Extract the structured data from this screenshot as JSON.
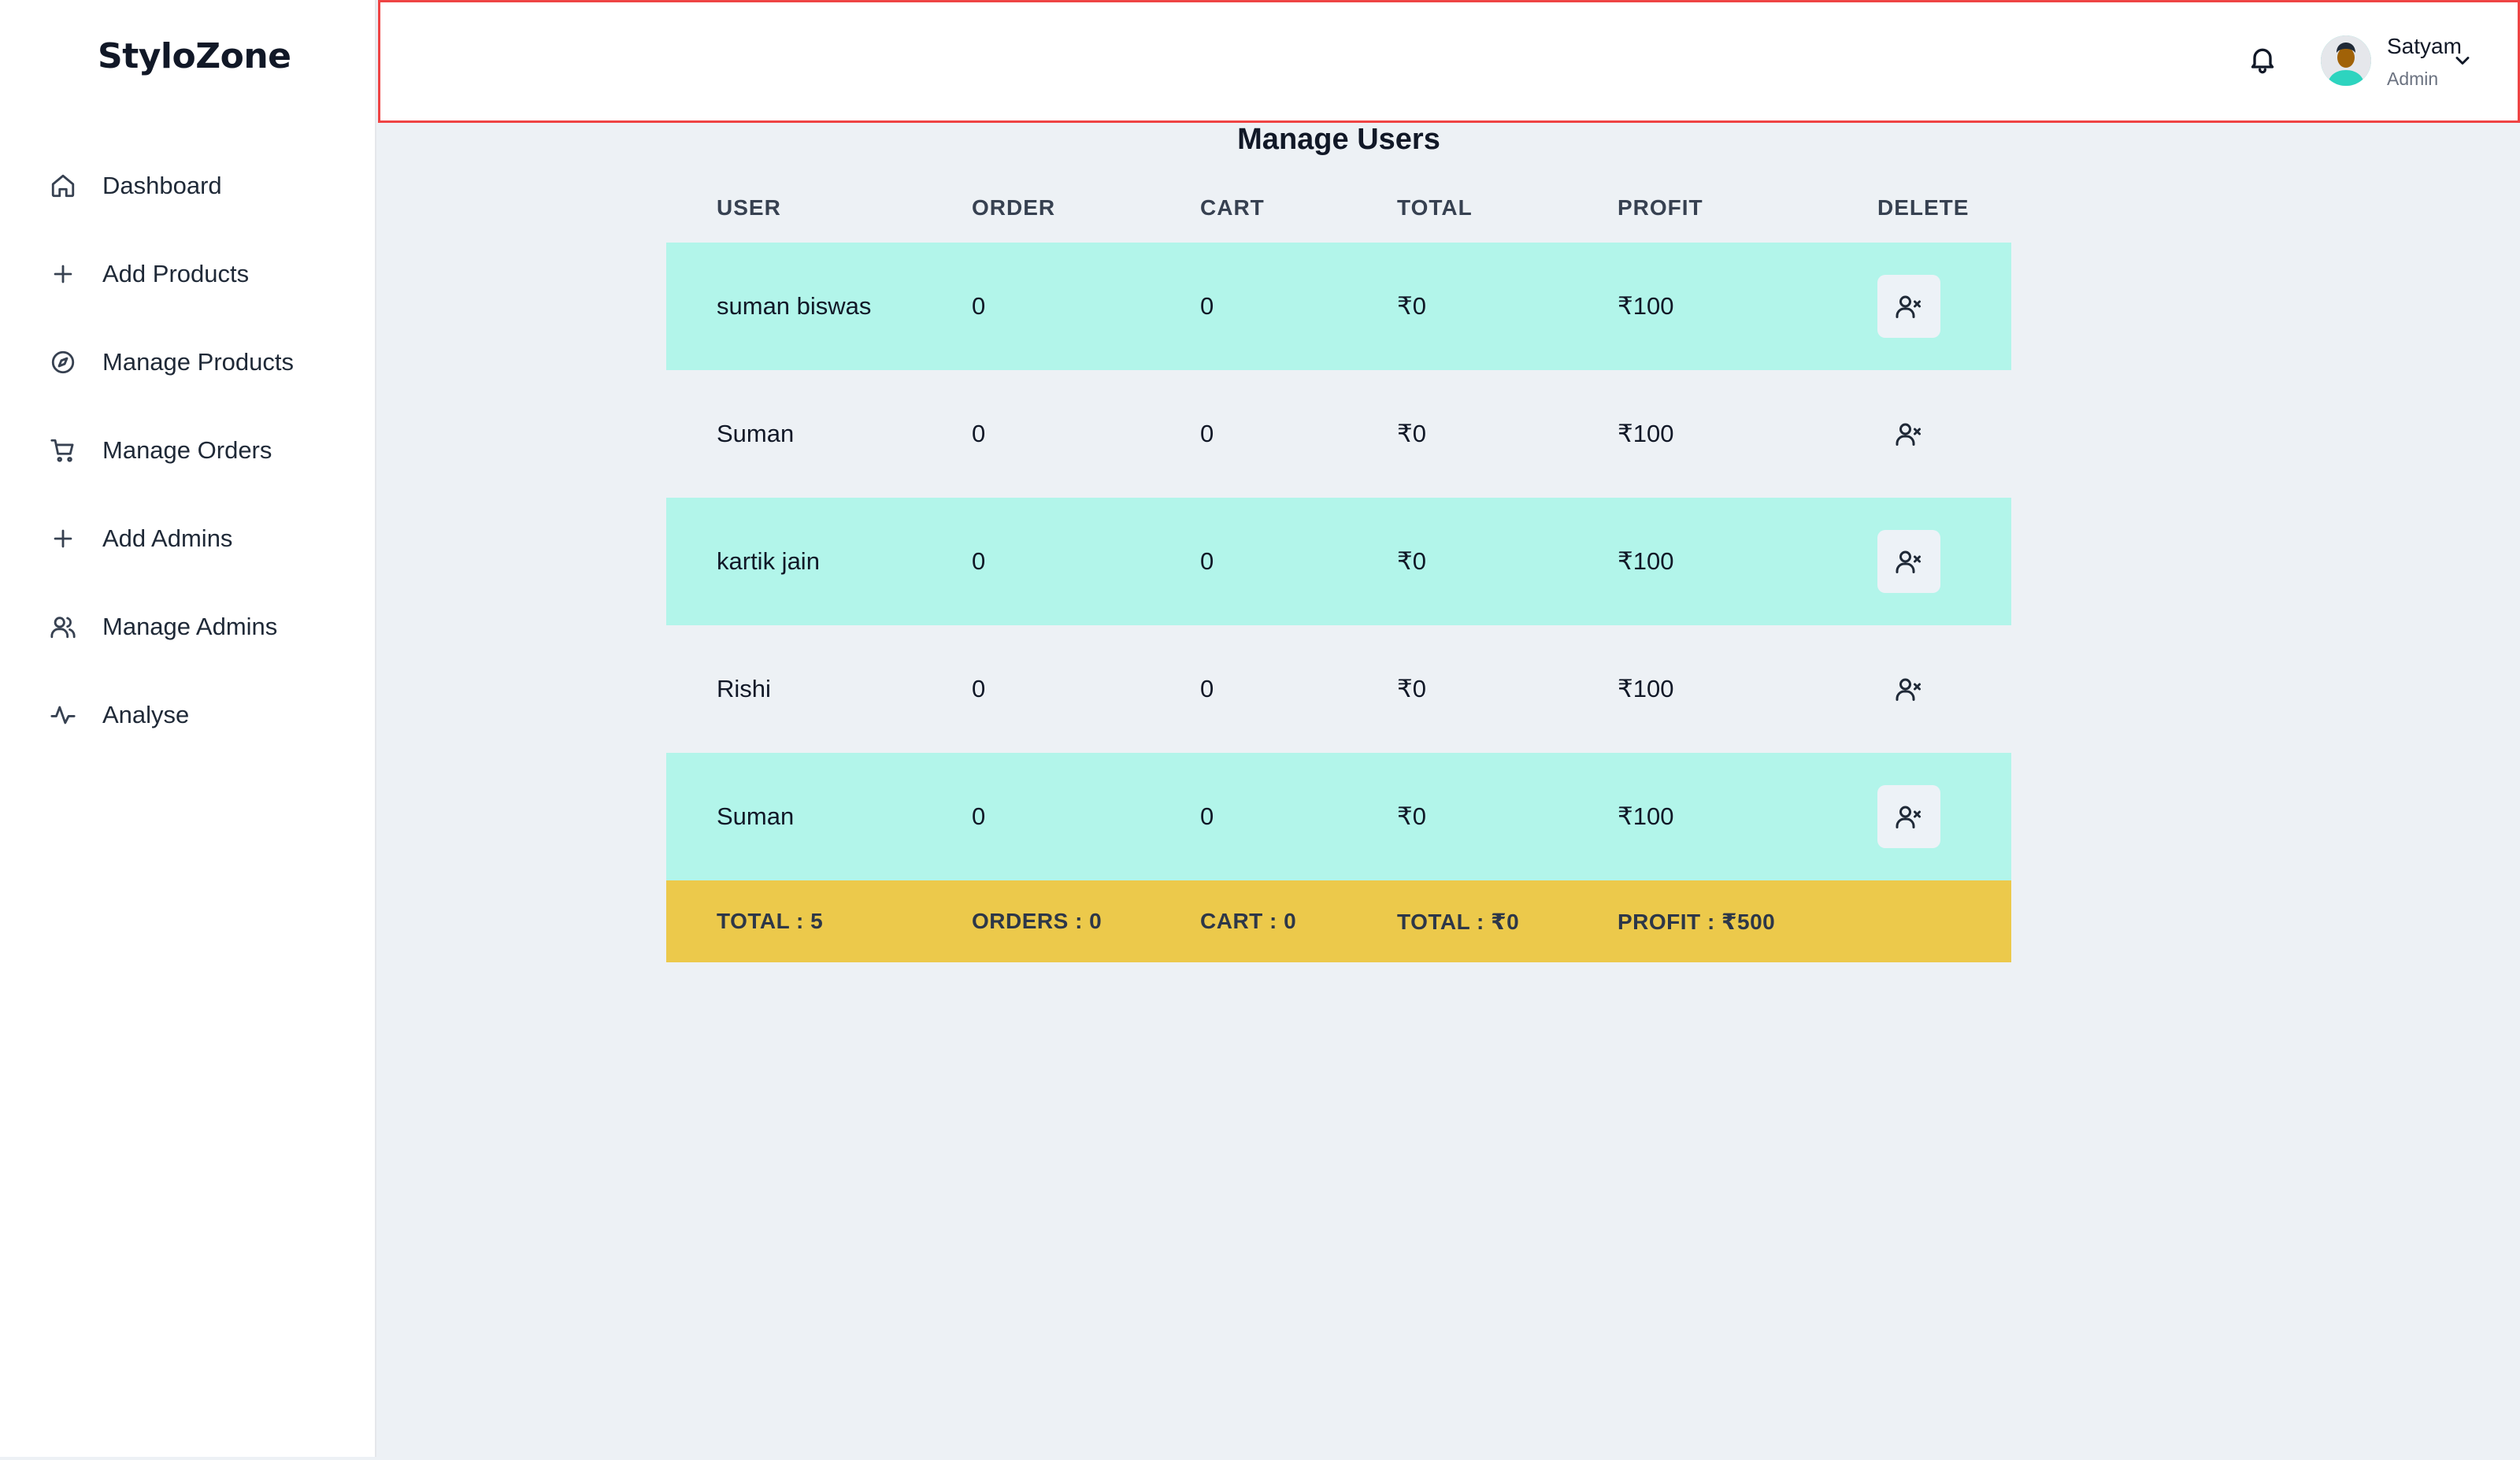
{
  "app": {
    "logo": "StyloZone"
  },
  "sidebar": {
    "items": [
      {
        "label": "Dashboard",
        "icon": "home-icon"
      },
      {
        "label": "Add Products",
        "icon": "plus-icon"
      },
      {
        "label": "Manage Products",
        "icon": "compass-icon"
      },
      {
        "label": "Manage Orders",
        "icon": "cart-icon"
      },
      {
        "label": "Add Admins",
        "icon": "plus-icon"
      },
      {
        "label": "Manage Admins",
        "icon": "users-icon"
      },
      {
        "label": "Analyse",
        "icon": "activity-icon"
      }
    ]
  },
  "header": {
    "user_name": "Satyam",
    "user_role": "Admin",
    "accent_border": "#ef4444"
  },
  "main": {
    "title": "Manage Users",
    "columns": [
      "USER",
      "ORDER",
      "CART",
      "TOTAL",
      "PROFIT",
      "DELETE"
    ],
    "rows": [
      {
        "user": "suman biswas",
        "order": "0",
        "cart": "0",
        "total": "₹0",
        "profit": "₹100"
      },
      {
        "user": "Suman",
        "order": "0",
        "cart": "0",
        "total": "₹0",
        "profit": "₹100"
      },
      {
        "user": "kartik jain",
        "order": "0",
        "cart": "0",
        "total": "₹0",
        "profit": "₹100"
      },
      {
        "user": "Rishi",
        "order": "0",
        "cart": "0",
        "total": "₹0",
        "profit": "₹100"
      },
      {
        "user": "Suman",
        "order": "0",
        "cart": "0",
        "total": "₹0",
        "profit": "₹100"
      }
    ],
    "footer": {
      "total": "TOTAL : 5",
      "orders": "ORDERS : 0",
      "cart": "CART : 0",
      "total_amount": "TOTAL : ₹0",
      "profit": "PROFIT : ₹500"
    }
  },
  "colors": {
    "row_highlight": "#b2f5ea",
    "footer": "#ecc94b",
    "background": "#edf1f5"
  }
}
